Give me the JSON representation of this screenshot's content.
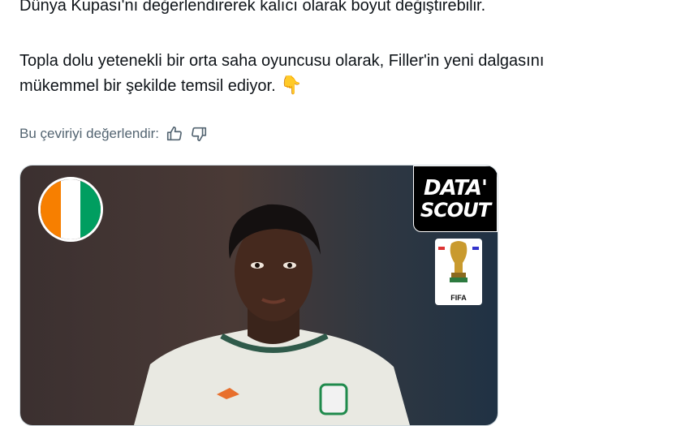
{
  "tweet": {
    "line1": "Dünya Kupası'nı değerlendirerek kalıcı olarak boyut değiştirebilir.",
    "line2": "Topla dolu yetenekli bir orta saha oyuncusu olarak, Filler'in yeni dalgasını",
    "line3": "mükemmel bir şekilde temsil ediyor.",
    "emoji": "👇"
  },
  "rating": {
    "label": "Bu çeviriyi değerlendir:",
    "icons": [
      "thumbs-up-icon",
      "thumbs-down-icon"
    ]
  },
  "media": {
    "logo_line1": "DATA'",
    "logo_line2": "SCOUT",
    "badge_label": "FIFA",
    "flag_colors": [
      "#f77f00",
      "#ffffff",
      "#009e60"
    ]
  }
}
